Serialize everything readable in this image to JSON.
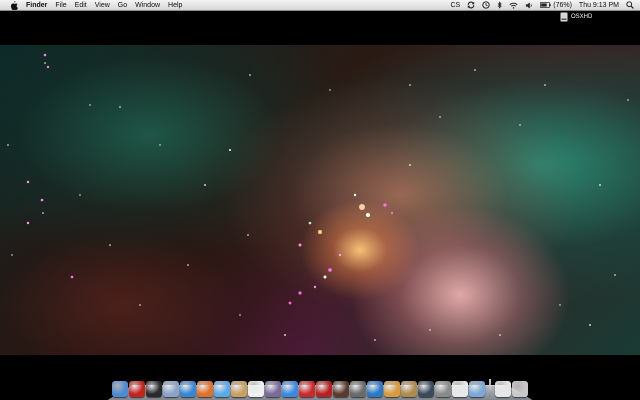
{
  "menubar": {
    "apple_icon": "apple-icon",
    "app_name": "Finder",
    "menus": [
      "File",
      "Edit",
      "View",
      "Go",
      "Window",
      "Help"
    ],
    "status": {
      "cs_label": "CS",
      "battery_percent_label": "(76%)",
      "clock": "Thu 9:13 PM"
    }
  },
  "desktop": {
    "drive_label": "OSXHD"
  },
  "dock": {
    "icons": [
      {
        "name": "finder-icon",
        "color": "#4a8ad8"
      },
      {
        "name": "red-app-icon",
        "color": "#c8201a"
      },
      {
        "name": "dashboard-icon",
        "color": "#2a2a2a"
      },
      {
        "name": "mail-icon",
        "color": "#8aa4c8"
      },
      {
        "name": "safari-icon",
        "color": "#3a86d6"
      },
      {
        "name": "firefox-icon",
        "color": "#e0702a"
      },
      {
        "name": "ichat-icon",
        "color": "#5aa8e8"
      },
      {
        "name": "address-book-icon",
        "color": "#c8a060"
      },
      {
        "name": "ical-icon",
        "color": "#f0f0f0"
      },
      {
        "name": "photo-icon",
        "color": "#7a6a9a"
      },
      {
        "name": "itunes-icon",
        "color": "#3a8ae0"
      },
      {
        "name": "front-row-icon",
        "color": "#cc2a2a"
      },
      {
        "name": "photo-booth-icon",
        "color": "#b82020"
      },
      {
        "name": "movie-icon",
        "color": "#5a3a2a"
      },
      {
        "name": "imovie-star-icon",
        "color": "#6a6a6a"
      },
      {
        "name": "app-store-icon",
        "color": "#2a78c8"
      },
      {
        "name": "garageband-icon",
        "color": "#d89a3a"
      },
      {
        "name": "preview-icon",
        "color": "#b08a4a"
      },
      {
        "name": "time-machine-icon",
        "color": "#3a4a5a"
      },
      {
        "name": "system-preferences-icon",
        "color": "#8a8a8a"
      },
      {
        "name": "textedit-icon",
        "color": "#e8e8e8"
      },
      {
        "name": "applications-folder-icon",
        "color": "#7aa8d8"
      },
      {
        "name": "documents-folder-icon",
        "color": "#e6e6e6"
      },
      {
        "name": "trash-icon",
        "color": "#c8c8c8"
      }
    ],
    "separator_after": 21
  }
}
